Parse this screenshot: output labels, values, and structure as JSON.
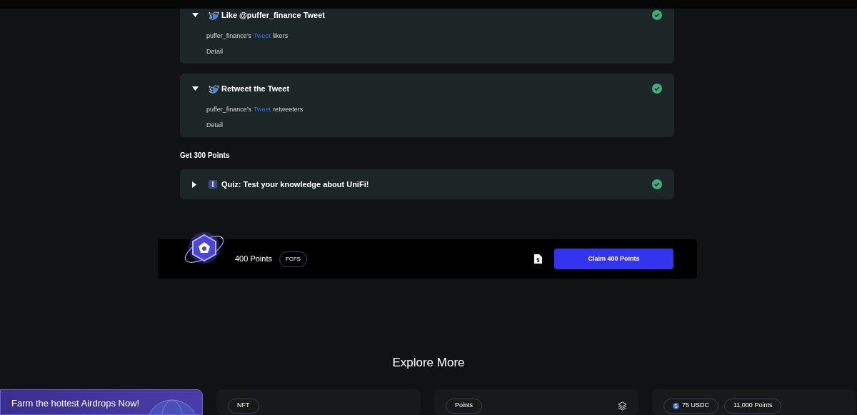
{
  "task_groups": [
    {
      "tasks": [
        {
          "kind": "tweet",
          "title": "Like @puffer_finance Tweet",
          "expanded": true,
          "completed": true,
          "description": {
            "before": "puffer_finance's",
            "link": "Tweet",
            "after": "likers"
          },
          "detail": "Detail"
        },
        {
          "kind": "tweet",
          "title": "Retweet the Tweet",
          "expanded": true,
          "completed": true,
          "description": {
            "before": "puffer_finance's",
            "link": "Tweet",
            "after": "retweeters"
          },
          "detail": "Detail"
        }
      ]
    },
    {
      "heading": "Get 300 Points",
      "tasks": [
        {
          "kind": "quiz",
          "title": "Quiz: Test your knowledge about UniFi!",
          "expanded": false,
          "completed": true
        }
      ]
    }
  ],
  "reward": {
    "points": "400 Points",
    "badge": "FCFS",
    "button": "Claim 400 Points"
  },
  "explore": {
    "title": "Explore More",
    "banner": "Farm the hottest Airdrops Now!",
    "cards": [
      {
        "tags": [
          {
            "kind": "plain",
            "text": "NFT"
          }
        ],
        "stack_icon": false
      },
      {
        "tags": [
          {
            "kind": "plain",
            "text": "Points"
          }
        ],
        "stack_icon": true
      },
      {
        "tags": [
          {
            "kind": "coin",
            "text": "75 USDC"
          },
          {
            "kind": "plain",
            "text": "11,000 Points"
          }
        ],
        "stack_icon": false
      }
    ]
  }
}
